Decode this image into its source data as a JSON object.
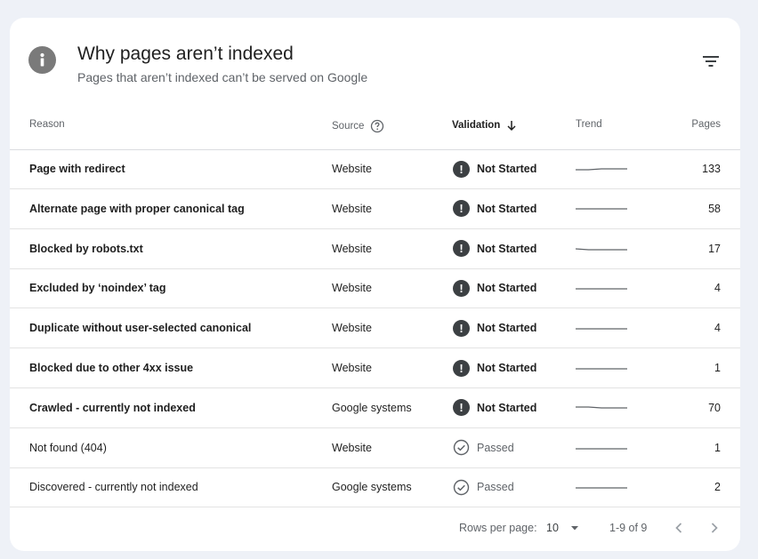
{
  "header": {
    "title": "Why pages aren’t indexed",
    "subtitle": "Pages that aren’t indexed can’t be served on Google",
    "info_icon": "info-icon",
    "filter_icon": "filter-icon"
  },
  "table": {
    "columns": {
      "reason": "Reason",
      "source": "Source",
      "validation": "Validation",
      "trend": "Trend",
      "pages": "Pages"
    },
    "sort": {
      "column": "validation",
      "direction": "descending"
    },
    "rows": [
      {
        "reason": "Page with redirect",
        "source": "Website",
        "validation": "Not Started",
        "pages": "133",
        "trend": [
          2,
          2,
          3,
          3,
          3
        ]
      },
      {
        "reason": "Alternate page with proper canonical tag",
        "source": "Website",
        "validation": "Not Started",
        "pages": "58",
        "trend": [
          3,
          3,
          3,
          3,
          3
        ]
      },
      {
        "reason": "Blocked by robots.txt",
        "source": "Website",
        "validation": "Not Started",
        "pages": "17",
        "trend": [
          3,
          2,
          2,
          2,
          2
        ]
      },
      {
        "reason": "Excluded by ‘noindex’ tag",
        "source": "Website",
        "validation": "Not Started",
        "pages": "4",
        "trend": [
          2,
          2,
          2,
          2,
          2
        ]
      },
      {
        "reason": "Duplicate without user-selected canonical",
        "source": "Website",
        "validation": "Not Started",
        "pages": "4",
        "trend": [
          2,
          2,
          2,
          2,
          2
        ]
      },
      {
        "reason": "Blocked due to other 4xx issue",
        "source": "Website",
        "validation": "Not Started",
        "pages": "1",
        "trend": [
          2,
          2,
          2,
          2,
          2
        ]
      },
      {
        "reason": "Crawled - currently not indexed",
        "source": "Google systems",
        "validation": "Not Started",
        "pages": "70",
        "trend": [
          4,
          4,
          3,
          3,
          3
        ]
      },
      {
        "reason": "Not found (404)",
        "source": "Website",
        "validation": "Passed",
        "pages": "1",
        "trend": [
          2,
          2,
          2,
          2,
          2
        ]
      },
      {
        "reason": "Discovered - currently not indexed",
        "source": "Google systems",
        "validation": "Passed",
        "pages": "2",
        "trend": [
          2,
          2,
          2,
          2,
          2
        ]
      }
    ]
  },
  "footer": {
    "rows_per_page_label": "Rows per page:",
    "rows_per_page_value": "10",
    "range": "1-9 of 9"
  },
  "colors": {
    "background": "#eef1f7",
    "card": "#ffffff",
    "alert_icon": "#3c4043",
    "trend_line": "#5f6368",
    "muted_text": "#5f6368"
  }
}
